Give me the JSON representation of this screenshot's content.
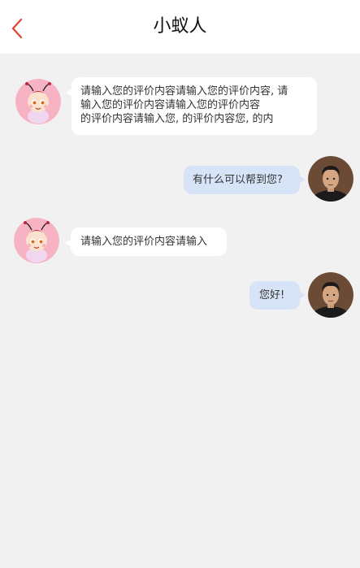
{
  "header": {
    "title": "小蚁人",
    "back_icon": "chevron-left-icon",
    "accent_color": "#e0452f"
  },
  "messages": [
    {
      "sender": "bot",
      "avatar_icon": "ant-mascot-avatar",
      "lines": [
        "请输入您的评价内容请输入您的评价内容, 请",
        "输入您的评价内容请输入您的评价内容",
        "的评价内容请输入您, 的评价内容您, 的内"
      ]
    },
    {
      "sender": "user",
      "avatar_icon": "user-photo-avatar",
      "lines": [
        "有什么可以帮到您?"
      ]
    },
    {
      "sender": "bot",
      "avatar_icon": "ant-mascot-avatar",
      "lines": [
        "请输入您的评价内容请输入"
      ]
    },
    {
      "sender": "user",
      "avatar_icon": "user-photo-avatar",
      "lines": [
        "您好!"
      ]
    }
  ]
}
